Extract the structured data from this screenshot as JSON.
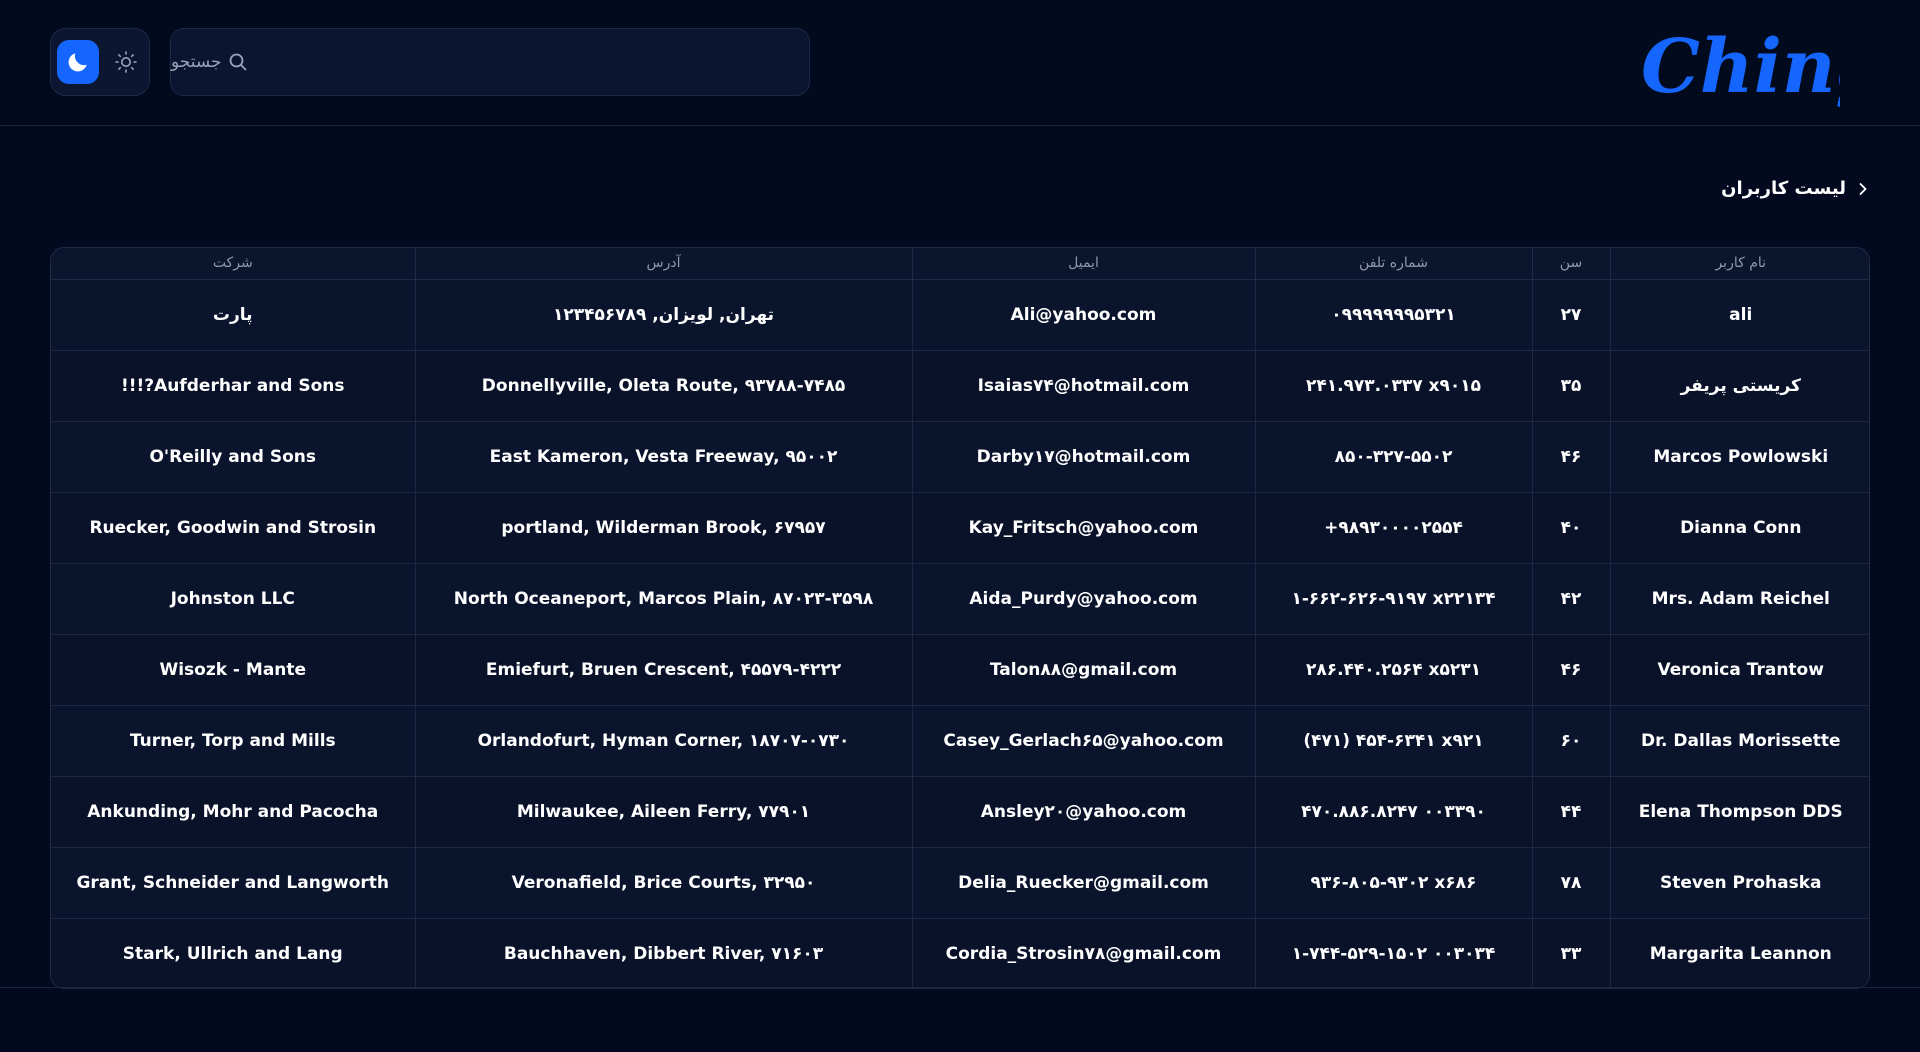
{
  "app": {
    "logo_text": "Chingal",
    "brand_color": "#1565ff"
  },
  "header": {
    "search_placeholder": "جستجو",
    "search_icon": "search-icon",
    "theme_toggle": {
      "dark_icon": "moon-icon",
      "light_icon": "sun-icon",
      "active": "dark"
    }
  },
  "breadcrumb": {
    "title": "لیست کاربران",
    "icon": "chevron-right-icon"
  },
  "table": {
    "headers": {
      "username": "نام کاربر",
      "age": "سن",
      "phone": "شماره تلفن",
      "email": "ایمیل",
      "address": "آدرس",
      "company": "شرکت"
    },
    "rows": [
      {
        "username": "ali",
        "age": "۲۷",
        "phone": "۰۹۹۹۹۹۹۹۵۳۲۱",
        "email": "Ali@yahoo.com",
        "address": "تهران, لویزان, ۱۲۳۴۵۶۷۸۹",
        "company": "پارت"
      },
      {
        "username": "کریستی پریفر",
        "age": "۳۵",
        "phone": "۲۴۱.۹۷۳.۰۳۳۷ x۹۰۱۵",
        "email": "Isaias۷۴@hotmail.com",
        "address": "Donnellyville, Oleta Route, ۹۳۷۸۸-۷۴۸۵",
        "company": "Aufderhar and Sons?!!!"
      },
      {
        "username": "Marcos Powlowski",
        "age": "۴۶",
        "phone": "۸۵۰-۳۲۷-۵۵۰۲",
        "email": "Darby۱۷@hotmail.com",
        "address": "East Kameron, Vesta Freeway, ۹۵۰۰۲",
        "company": "O'Reilly and Sons"
      },
      {
        "username": "Dianna Conn",
        "age": "۴۰",
        "phone": "+۹۸۹۳۰۰۰۰۲۵۵۴",
        "email": "Kay_Fritsch@yahoo.com",
        "address": "portland, Wilderman Brook, ۶۷۹۵۷",
        "company": "Ruecker, Goodwin and Strosin"
      },
      {
        "username": "Mrs. Adam Reichel",
        "age": "۴۲",
        "phone": "۱-۶۶۲-۶۲۶-۹۱۹۷ x۲۲۱۳۴",
        "email": "Aida_Purdy@yahoo.com",
        "address": "North Oceaneport, Marcos Plain, ۸۷۰۲۳-۳۵۹۸",
        "company": "Johnston LLC"
      },
      {
        "username": "Veronica Trantow",
        "age": "۴۶",
        "phone": "۲۸۶.۴۴۰.۲۵۶۴ x۵۲۳۱",
        "email": "Talon۸۸@gmail.com",
        "address": "Emiefurt, Bruen Crescent, ۴۵۵۷۹-۴۲۲۲",
        "company": "Wisozk - Mante"
      },
      {
        "username": "Dr. Dallas Morissette",
        "age": "۶۰",
        "phone": "(۴۷۱) ۴۵۴-۶۳۴۱ x۹۲۱",
        "email": "Casey_Gerlach۶۵@yahoo.com",
        "address": "Orlandofurt, Hyman Corner, ۱۸۷۰۷-۰۷۳۰",
        "company": "Turner, Torp and Mills"
      },
      {
        "username": "Elena Thompson DDS",
        "age": "۴۴",
        "phone": "۴۷۰.۸۸۶.۸۲۴۷ ۰۰۳۳۹۰",
        "email": "Ansley۲۰@yahoo.com",
        "address": "Milwaukee, Aileen Ferry, ۷۷۹۰۱",
        "company": "Ankunding, Mohr and Pacocha"
      },
      {
        "username": "Steven Prohaska",
        "age": "۷۸",
        "phone": "۹۳۶-۸۰۵-۹۳۰۲ x۶۸۶",
        "email": "Delia_Ruecker@gmail.com",
        "address": "Veronafield, Brice Courts, ۳۲۹۵۰",
        "company": "Grant, Schneider and Langworth"
      },
      {
        "username": "Margarita Leannon",
        "age": "۳۳",
        "phone": "۱-۷۴۴-۵۲۹-۱۵۰۲ ۰۰۳۰۳۴",
        "email": "Cordia_Strosin۷۸@gmail.com",
        "address": "Bauchhaven, Dibbert River, ۷۱۶۰۳",
        "company": "Stark, Ullrich and Lang"
      }
    ]
  }
}
